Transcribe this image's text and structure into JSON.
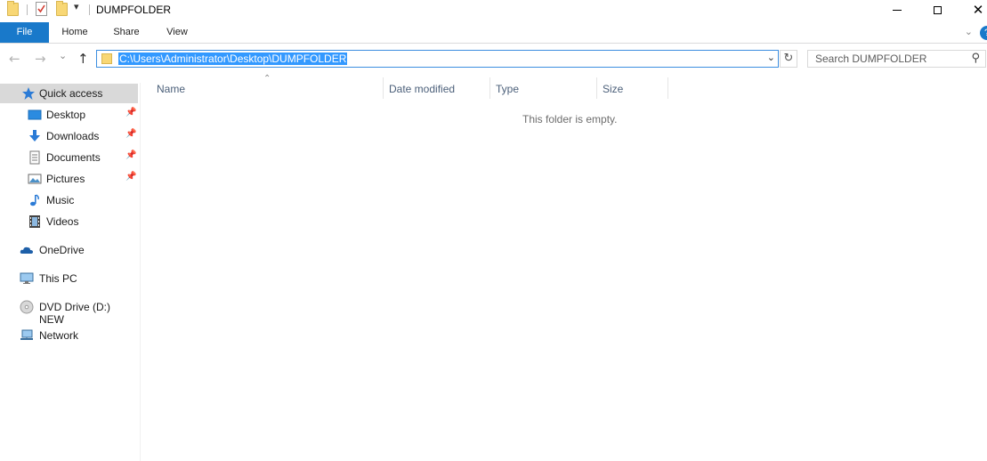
{
  "window": {
    "title": "DUMPFOLDER"
  },
  "ribbon": {
    "tabs": [
      "File",
      "Home",
      "Share",
      "View"
    ],
    "expand_glyph": "⌄",
    "help_glyph": "?"
  },
  "navigation": {
    "back_glyph": "←",
    "forward_glyph": "→",
    "recent_glyph": "⌄",
    "up_glyph": "↑",
    "refresh_glyph": "↻"
  },
  "address_bar": {
    "path": "C:\\Users\\Administrator\\Desktop\\DUMPFOLDER",
    "dropdown_glyph": "⌄"
  },
  "search": {
    "placeholder": "Search DUMPFOLDER",
    "icon_glyph": "⚲"
  },
  "sidebar": {
    "quick_access": "Quick access",
    "pinned": [
      {
        "label": "Desktop",
        "icon": "desktop-icon",
        "pinned": true
      },
      {
        "label": "Downloads",
        "icon": "downloads-icon",
        "pinned": true
      },
      {
        "label": "Documents",
        "icon": "documents-icon",
        "pinned": true
      },
      {
        "label": "Pictures",
        "icon": "pictures-icon",
        "pinned": true
      },
      {
        "label": "Music",
        "icon": "music-icon",
        "pinned": false
      },
      {
        "label": "Videos",
        "icon": "videos-icon",
        "pinned": false
      }
    ],
    "onedrive": "OneDrive",
    "this_pc": "This PC",
    "dvd_drive": "DVD Drive (D:) NEW",
    "network": "Network"
  },
  "content": {
    "columns": [
      "Name",
      "Date modified",
      "Type",
      "Size"
    ],
    "empty_message": "This folder is empty."
  },
  "colors": {
    "accent": "#1979ca",
    "selection": "#3399ff",
    "nav_selected": "#d9d9d9",
    "folder": "#f8d775"
  }
}
